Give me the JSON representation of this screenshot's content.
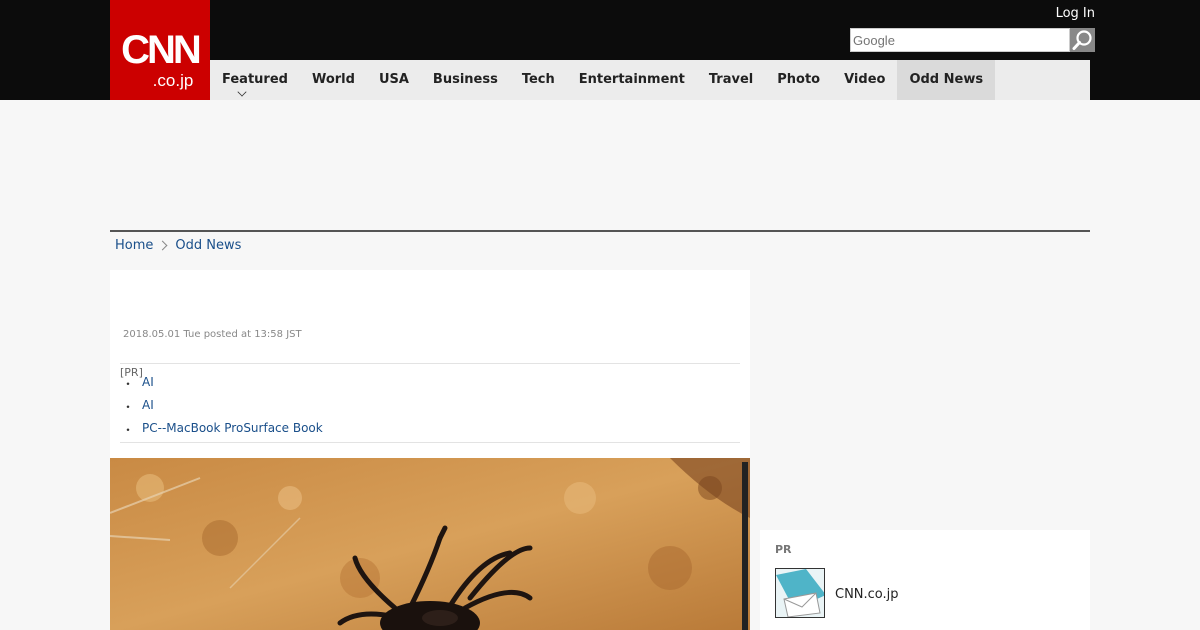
{
  "header": {
    "logo_main": "CNN",
    "logo_sub": ".co.jp",
    "login_label": "Log In",
    "search_placeholder": "Google"
  },
  "nav": {
    "items": [
      {
        "label": "Featured"
      },
      {
        "label": "World"
      },
      {
        "label": "USA"
      },
      {
        "label": "Business"
      },
      {
        "label": "Tech"
      },
      {
        "label": "Entertainment"
      },
      {
        "label": "Travel"
      },
      {
        "label": "Photo"
      },
      {
        "label": "Video"
      },
      {
        "label": "Odd News"
      }
    ]
  },
  "breadcrumb": {
    "home": "Home",
    "current": "Odd News"
  },
  "article": {
    "dateline": "2018.05.01 Tue posted at 13:58 JST",
    "pr_tag": "[PR]",
    "pr_links": [
      "AI",
      "AI",
      "PC--MacBook ProSurface Book"
    ]
  },
  "sidebar": {
    "pr_label": "PR",
    "pr_item_text": "CNN.co.jp"
  },
  "colors": {
    "brand_red": "#cc0000",
    "header_bg": "#0c0c0c",
    "link": "#1a4f8a"
  }
}
